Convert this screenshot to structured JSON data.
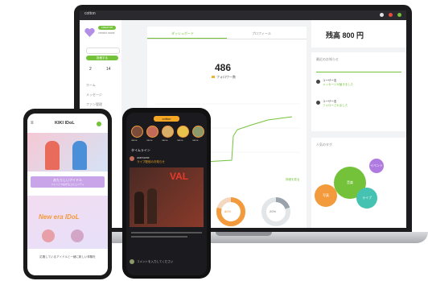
{
  "laptop": {
    "app_title": "cotton",
    "header_price": "残高 800 円",
    "tabs": [
      "ダッシュボード",
      "プロフィール"
    ],
    "stat_value": "486",
    "stat_label": "フォロワー数",
    "status_link": "詳細を見る",
    "sidebar": {
      "profile_badge": "CREATOR",
      "profile_name": "creator name",
      "primary_button": "投稿する",
      "counts": [
        "2",
        "14"
      ],
      "menu": [
        "ホーム",
        "メッセージ",
        "ファン管理",
        "設定"
      ]
    },
    "right": {
      "news_title": "最近のお知らせ",
      "news_items": [
        {
          "title": "ユーザー名",
          "text": "メッセージが届きました"
        },
        {
          "title": "ユーザー名",
          "text": "フォローされました"
        }
      ],
      "popular_title": "人気のタグ",
      "tags": [
        "音楽",
        "写真",
        "ライブ",
        "イベント"
      ]
    },
    "donut_labels": [
      "80%",
      "20%"
    ],
    "colors": {
      "accent": "#74c23a",
      "orange": "#f29a3c",
      "purple": "#b07be0",
      "teal": "#45c2b1"
    }
  },
  "phone1": {
    "brand": "KIKI IDoL",
    "banner": "あたらしいアイドル",
    "banner_sub": "ファンとつながるコミュニティ",
    "hero_text": "New era IDoL",
    "caption": "応援しているアイドルと一緒に新しい体験を"
  },
  "phone2": {
    "brand": "cotton",
    "stories": [
      "name",
      "name",
      "name",
      "name",
      "name"
    ],
    "section": "タイムライン",
    "post_title": "ライブ配信のお知らせ",
    "post_user": "username",
    "poster_text": "VAL",
    "comment": "コメントを入力してください"
  }
}
